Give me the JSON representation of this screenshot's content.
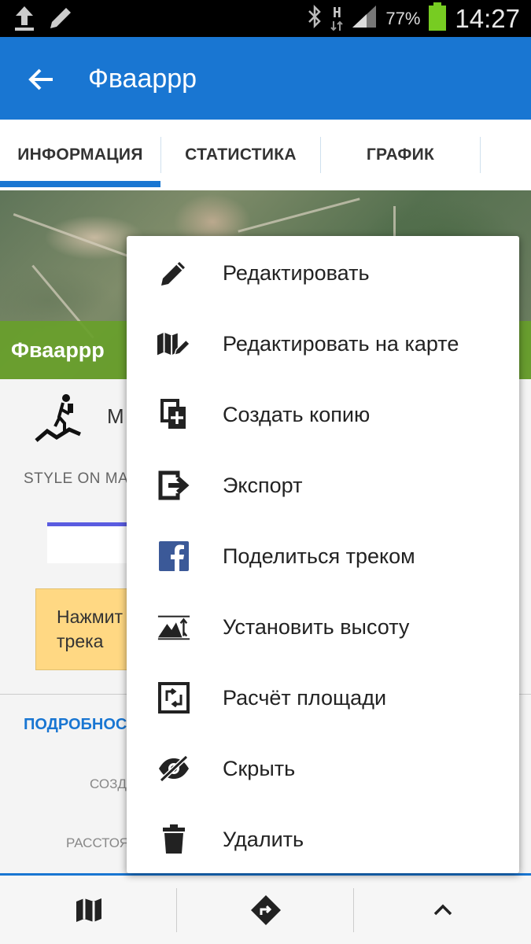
{
  "status_bar": {
    "battery_percent": "77%",
    "time": "14:27",
    "network_type": "H",
    "icons": [
      "upload-icon",
      "pencil-icon",
      "bluetooth-icon",
      "network-h-icon",
      "signal-icon",
      "battery-icon"
    ]
  },
  "app_bar": {
    "title": "Фваарpp",
    "back_icon": "arrow-back-icon"
  },
  "tabs": [
    {
      "label": "ИНФОРМАЦИЯ",
      "selected": true
    },
    {
      "label": "СТАТИСТИКА",
      "selected": false
    },
    {
      "label": "ГРАФИК",
      "selected": false
    }
  ],
  "map": {
    "track_name": "Фваарpp"
  },
  "info": {
    "activity_text": "М",
    "style_label": "STYLE ON MA",
    "hint_text_line1": "Нажмит",
    "hint_text_line2": "трека",
    "details_title": "ПОДРОБНОС",
    "detail_created_label": "СОЗД",
    "detail_distance_label": "РАССТОЯ"
  },
  "menu": {
    "items": [
      {
        "label": "Редактировать",
        "icon": "pencil-icon"
      },
      {
        "label": "Редактировать на карте",
        "icon": "map-edit-icon"
      },
      {
        "label": "Создать копию",
        "icon": "copy-add-icon"
      },
      {
        "label": "Экспорт",
        "icon": "export-icon"
      },
      {
        "label": "Поделиться треком",
        "icon": "facebook-icon"
      },
      {
        "label": "Установить высоту",
        "icon": "elevation-icon"
      },
      {
        "label": "Расчёт площади",
        "icon": "area-icon"
      },
      {
        "label": "Скрыть",
        "icon": "eye-off-icon"
      },
      {
        "label": "Удалить",
        "icon": "trash-icon"
      }
    ]
  },
  "bottom_bar": {
    "buttons": [
      {
        "icon": "map-icon"
      },
      {
        "icon": "navigation-icon"
      },
      {
        "icon": "chevron-up-icon"
      }
    ]
  },
  "colors": {
    "primary": "#1976d2",
    "track_label_bg": "#68a02a",
    "hint_bg": "#ffd883",
    "facebook": "#3b5998"
  }
}
